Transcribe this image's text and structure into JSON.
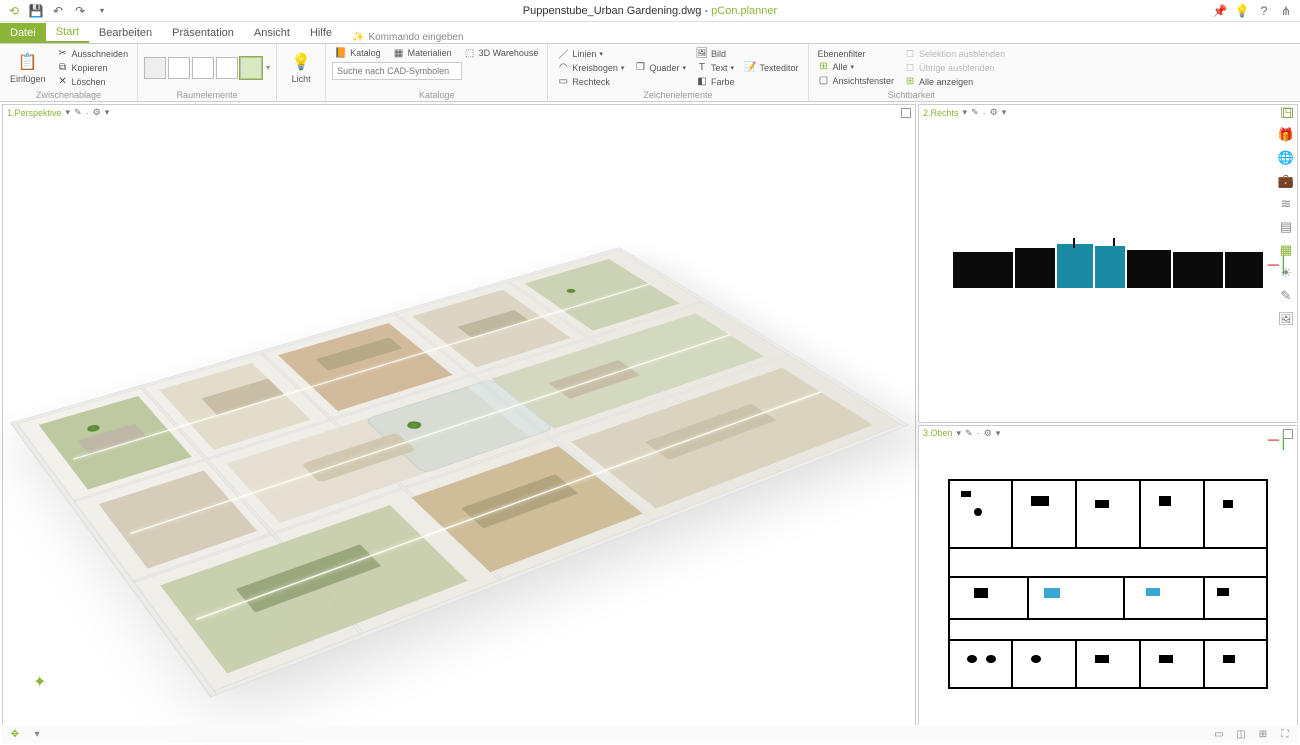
{
  "title": {
    "filename": "Puppenstube_Urban Gardening.dwg",
    "separator": " - ",
    "app": "pCon.planner"
  },
  "tabs": {
    "file": "Datei",
    "start": "Start",
    "bearbeiten": "Bearbeiten",
    "praesentation": "Präsentation",
    "ansicht": "Ansicht",
    "hilfe": "Hilfe",
    "kommando": "Kommando eingeben"
  },
  "ribbon": {
    "zwisch": {
      "label": "Zwischenablage",
      "einfuegen": "Einfügen",
      "ausschneiden": "Ausschneiden",
      "kopieren": "Kopieren",
      "loeschen": "Löschen"
    },
    "raum": {
      "label": "Raumelemente"
    },
    "licht": {
      "label": "",
      "licht": "Licht"
    },
    "kataloge": {
      "label": "Kataloge",
      "katalog": "Katalog",
      "materialien": "Materialien",
      "warehouse": "3D Warehouse",
      "search_placeholder": "Suche nach CAD-Symbolen"
    },
    "zeichen": {
      "label": "Zeichenelemente",
      "linien": "Linien",
      "kreisbogen": "Kreisbogen",
      "rechteck": "Rechteck",
      "quader": "Quader",
      "bild": "Bild",
      "text": "Text",
      "farbe": "Farbe",
      "texteditor": "Texteditor"
    },
    "sicht": {
      "label": "Sichtbarkeit",
      "ebenenfilter": "Ebenenfilter",
      "alle": "Alle",
      "ansichtsfenster": "Ansichtsfenster",
      "selektion_aus": "Selektion ausblenden",
      "uebrige_aus": "Übrige ausblenden",
      "alle_anzeigen": "Alle anzeigen"
    }
  },
  "viewports": {
    "persp": "1.Perspektive",
    "rechts": "2.Rechts",
    "oben": "3.Oben"
  }
}
